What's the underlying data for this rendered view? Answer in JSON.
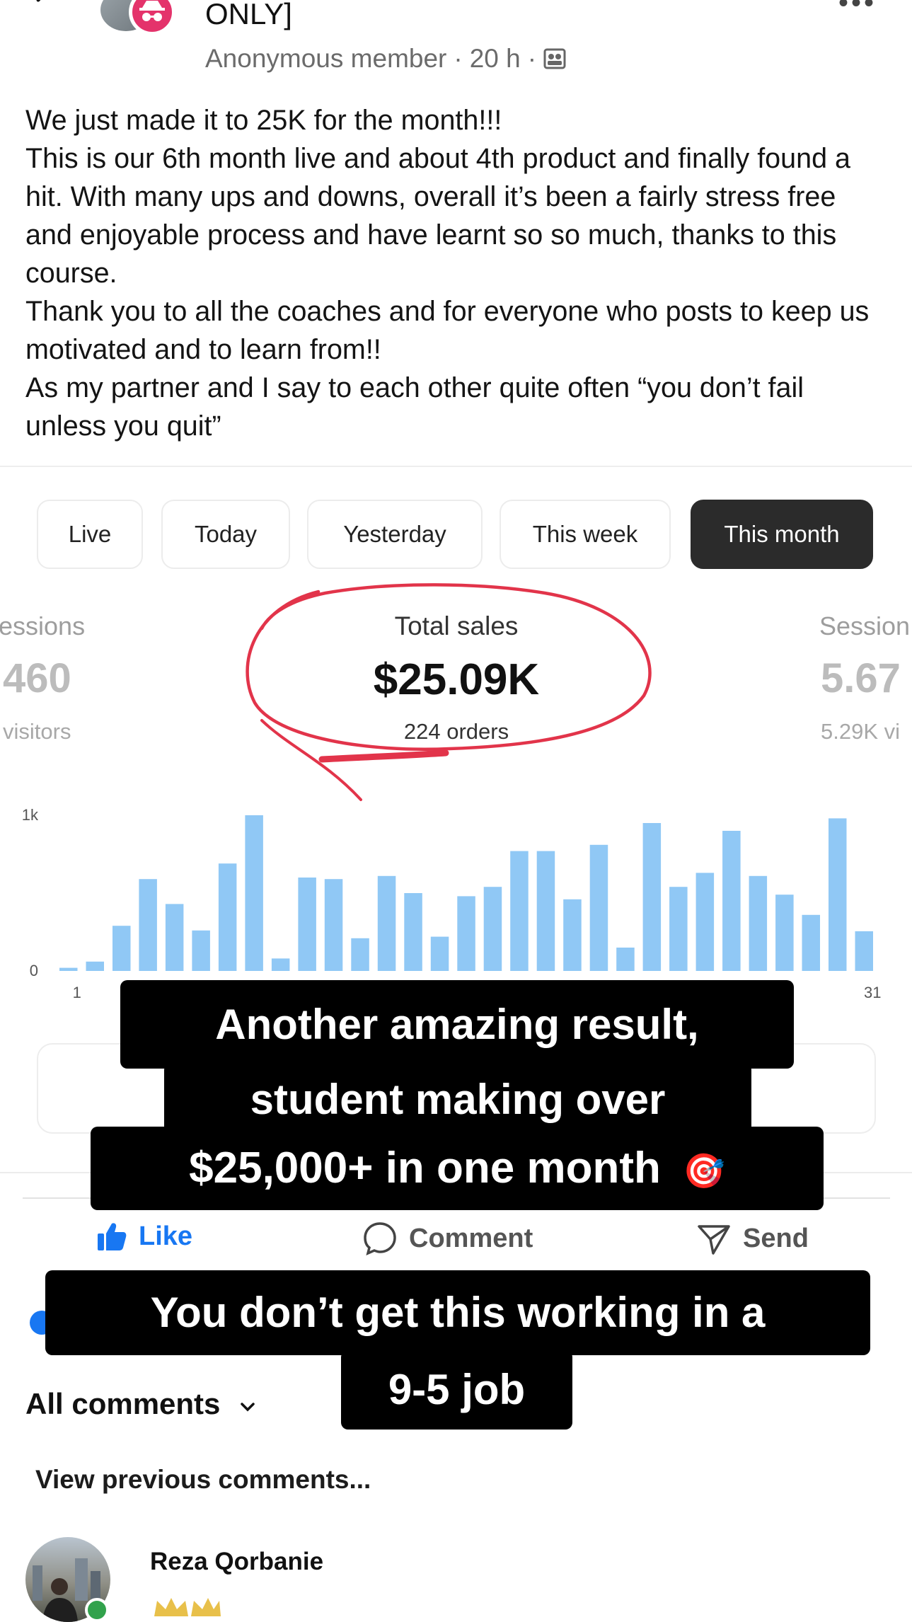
{
  "header": {
    "group_name": "ONLY]",
    "member": "Anonymous member",
    "separator": "·",
    "time": "20 h",
    "privacy_icon": "members-icon"
  },
  "post": {
    "lines": [
      "We just made it to 25K for the month!!!",
      "This is our 6th month live and about 4th product and finally found a hit. With many ups and downs, overall it’s been a fairly stress free and enjoyable process and have learnt so so much, thanks to this course.",
      "Thank you to all the coaches and for everyone who posts to keep us motivated and to learn from!!",
      "As my partner and I say to each other quite often “you don’t fail unless you quit”"
    ]
  },
  "dashboard": {
    "tabs": [
      "Live",
      "Today",
      "Yesterday",
      "This week",
      "This month"
    ],
    "active_tab": "This month",
    "left_metric": {
      "label": "essions",
      "value": "460",
      "sub": "visitors"
    },
    "total": {
      "label": "Total sales",
      "value": "$25.09K",
      "sub": "224 orders"
    },
    "right_metric": {
      "label": "Session",
      "value": "5.67",
      "sub": "5.29K vi"
    },
    "highlight_color": "#e2344a"
  },
  "chart_data": {
    "type": "bar",
    "ytick_labels": [
      "1k",
      "0"
    ],
    "xtick_labels": [
      "1",
      "31"
    ],
    "x": [
      1,
      2,
      3,
      4,
      5,
      6,
      7,
      8,
      9,
      10,
      11,
      12,
      13,
      14,
      15,
      16,
      17,
      18,
      19,
      20,
      21,
      22,
      23,
      24,
      25,
      26,
      27,
      28,
      29,
      30,
      31
    ],
    "values": [
      20,
      60,
      290,
      590,
      430,
      260,
      690,
      1000,
      80,
      600,
      590,
      210,
      610,
      500,
      220,
      480,
      540,
      770,
      770,
      460,
      810,
      150,
      950,
      540,
      630,
      900,
      610,
      490,
      360,
      980,
      255
    ],
    "ylim": [
      0,
      1100
    ],
    "bar_color": "#90c8f5",
    "grid": false
  },
  "actions": {
    "like": "Like",
    "comment": "Comment",
    "send": "Send"
  },
  "comments": {
    "filter": "All comments",
    "view_previous": "View previous comments...",
    "commenter": "Reza Qorbanie"
  },
  "overlay": {
    "caption1_lines": [
      "Another amazing result,",
      "student making over",
      "$25,000+ in one month"
    ],
    "caption1_emoji": "🎯",
    "caption2_lines": [
      "You don’t get this working in a",
      "9-5 job"
    ]
  }
}
